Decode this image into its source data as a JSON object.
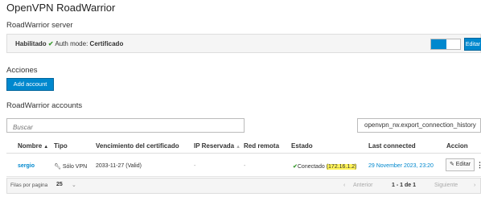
{
  "page": {
    "title": "OpenVPN RoadWarrior"
  },
  "server": {
    "section_title": "RoadWarrior server",
    "status_label": "Habilitado",
    "auth_label": "Auth mode:",
    "auth_value": "Certificado",
    "toggle_on": true,
    "edit_label": "Editar"
  },
  "actions": {
    "section_title": "Acciones",
    "add_label": "Add account"
  },
  "accounts": {
    "section_title": "RoadWarrior accounts",
    "search_placeholder": "Buscar",
    "export_label": "openvpn_rw.export_connection_history",
    "columns": {
      "name": "Nombre",
      "type": "Tipo",
      "expiry": "Vencimiento del certificado",
      "reserved_ip": "IP Reservada",
      "remote_net": "Red remota",
      "state": "Estado",
      "last_connected": "Last connected",
      "action": "Accion"
    },
    "rows": [
      {
        "name": "sergio",
        "type": "Sólo VPN",
        "expiry": "2033-11-27 (Valid)",
        "reserved_ip": "-",
        "remote_net": "-",
        "state": "Conectado",
        "ip": "172.16.1.2",
        "last_connected": "29 November 2023, 23:20",
        "edit_label": "Editar"
      }
    ],
    "pagination": {
      "per_page_label": "Filas por pagina",
      "per_page_value": "25",
      "previous_label": "Anterior",
      "range_label": "1 - 1 de 1",
      "next_label": "Siguiente"
    }
  },
  "colors": {
    "primary": "#0088ce",
    "success": "#3f9c35",
    "ip_highlight": "#fff35a"
  }
}
